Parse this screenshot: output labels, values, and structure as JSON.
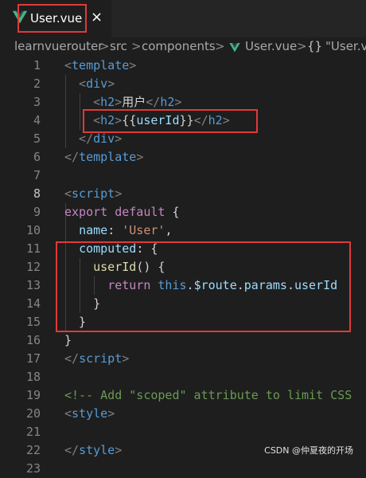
{
  "tab": {
    "label": "User.vue",
    "close": "×",
    "icon": "vue-icon"
  },
  "breadcrumb": {
    "items": [
      "learnvuerouter",
      "src",
      "components",
      "User.vue",
      "\"User.vu"
    ],
    "separator": ">",
    "symbol": "{}"
  },
  "lines": [
    {
      "n": "1",
      "tokens": [
        [
          "t-punc",
          "<"
        ],
        [
          "t-tag",
          "template"
        ],
        [
          "t-punc",
          ">"
        ]
      ]
    },
    {
      "n": "2",
      "tokens": [
        [
          "t-punc",
          "  <"
        ],
        [
          "t-tag",
          "div"
        ],
        [
          "t-punc",
          ">"
        ]
      ]
    },
    {
      "n": "3",
      "tokens": [
        [
          "t-punc",
          "    <"
        ],
        [
          "t-tag",
          "h2"
        ],
        [
          "t-punc",
          ">"
        ],
        [
          "t-txt",
          "用户"
        ],
        [
          "t-punc",
          "</"
        ],
        [
          "t-tag",
          "h2"
        ],
        [
          "t-punc",
          ">"
        ]
      ]
    },
    {
      "n": "4",
      "tokens": [
        [
          "t-punc",
          "    <"
        ],
        [
          "t-tag",
          "h2"
        ],
        [
          "t-punc",
          ">"
        ],
        [
          "t-txt",
          "{{"
        ],
        [
          "t-key",
          "userId"
        ],
        [
          "t-txt",
          "}}"
        ],
        [
          "t-punc",
          "</"
        ],
        [
          "t-tag",
          "h2"
        ],
        [
          "t-punc",
          ">"
        ]
      ]
    },
    {
      "n": "5",
      "tokens": [
        [
          "t-punc",
          "  </"
        ],
        [
          "t-tag",
          "div"
        ],
        [
          "t-punc",
          ">"
        ]
      ]
    },
    {
      "n": "6",
      "tokens": [
        [
          "t-punc",
          "</"
        ],
        [
          "t-tag",
          "template"
        ],
        [
          "t-punc",
          ">"
        ]
      ]
    },
    {
      "n": "7",
      "tokens": []
    },
    {
      "n": "8",
      "tokens": [
        [
          "t-punc",
          "<"
        ],
        [
          "t-tag",
          "script"
        ],
        [
          "t-punc",
          ">"
        ]
      ]
    },
    {
      "n": "9",
      "tokens": [
        [
          "t-kw",
          "export"
        ],
        [
          "t-txt",
          " "
        ],
        [
          "t-kw",
          "default"
        ],
        [
          "t-txt",
          " {"
        ]
      ]
    },
    {
      "n": "10",
      "tokens": [
        [
          "t-txt",
          "  "
        ],
        [
          "t-key",
          "name"
        ],
        [
          "t-txt",
          ": "
        ],
        [
          "t-str",
          "'User'"
        ],
        [
          "t-txt",
          ","
        ]
      ]
    },
    {
      "n": "11",
      "tokens": [
        [
          "t-txt",
          "  "
        ],
        [
          "t-key",
          "computed"
        ],
        [
          "t-txt",
          ": {"
        ]
      ]
    },
    {
      "n": "12",
      "tokens": [
        [
          "t-txt",
          "    "
        ],
        [
          "t-fn",
          "userId"
        ],
        [
          "t-txt",
          "() {"
        ]
      ]
    },
    {
      "n": "13",
      "tokens": [
        [
          "t-txt",
          "      "
        ],
        [
          "t-kw",
          "return"
        ],
        [
          "t-txt",
          " "
        ],
        [
          "t-this",
          "this"
        ],
        [
          "t-txt",
          "."
        ],
        [
          "t-key",
          "$route"
        ],
        [
          "t-txt",
          "."
        ],
        [
          "t-key",
          "params"
        ],
        [
          "t-txt",
          "."
        ],
        [
          "t-key",
          "userId"
        ]
      ]
    },
    {
      "n": "14",
      "tokens": [
        [
          "t-txt",
          "    }"
        ]
      ]
    },
    {
      "n": "15",
      "tokens": [
        [
          "t-txt",
          "  }"
        ]
      ]
    },
    {
      "n": "16",
      "tokens": [
        [
          "t-txt",
          "}"
        ]
      ]
    },
    {
      "n": "17",
      "tokens": [
        [
          "t-punc",
          "</"
        ],
        [
          "t-tag",
          "script"
        ],
        [
          "t-punc",
          ">"
        ]
      ]
    },
    {
      "n": "18",
      "tokens": []
    },
    {
      "n": "19",
      "tokens": [
        [
          "t-com",
          "<!-- Add \"scoped\" attribute to limit CSS"
        ]
      ]
    },
    {
      "n": "20",
      "tokens": [
        [
          "t-punc",
          "<"
        ],
        [
          "t-tag",
          "style"
        ],
        [
          "t-punc",
          ">"
        ]
      ]
    },
    {
      "n": "21",
      "tokens": []
    },
    {
      "n": "22",
      "tokens": [
        [
          "t-punc",
          "</"
        ],
        [
          "t-tag",
          "style"
        ],
        [
          "t-punc",
          ">"
        ]
      ]
    },
    {
      "n": "23",
      "tokens": []
    }
  ],
  "active_line": "8",
  "watermark": "CSDN @仲夏夜的开场",
  "colors": {
    "highlight_box": "#e03a3a",
    "background": "#1e1e1e",
    "vue_green": "#42b883"
  }
}
